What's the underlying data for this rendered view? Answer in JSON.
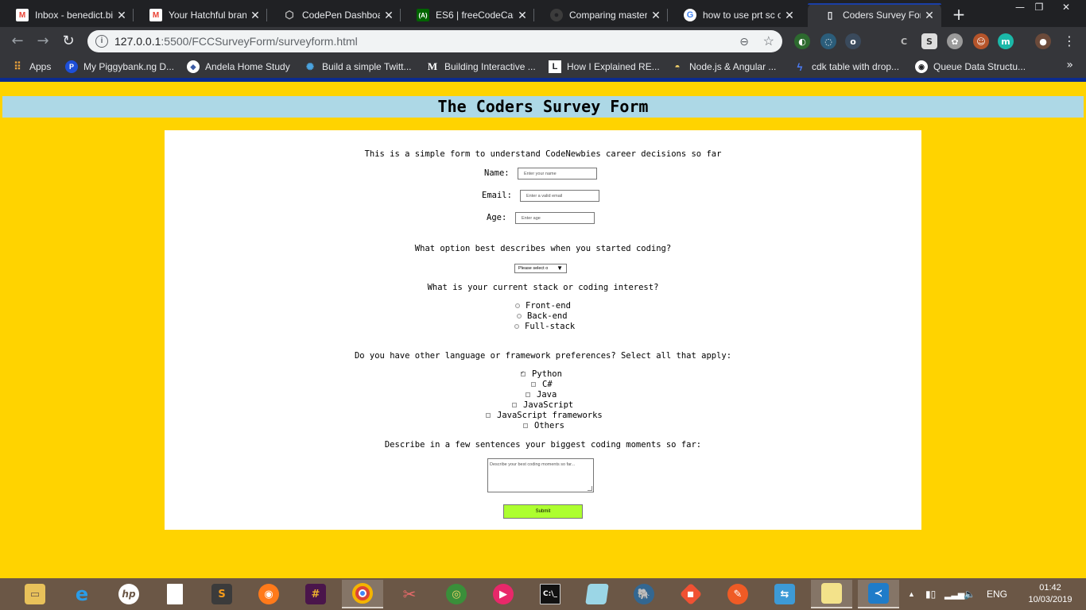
{
  "browser": {
    "tabs": [
      {
        "title": "Inbox - benedict.bi",
        "icon": "gmail-icon",
        "active": false
      },
      {
        "title": "Your Hatchful brand",
        "icon": "gmail-icon",
        "active": false
      },
      {
        "title": "CodePen Dashboar",
        "icon": "codepen-icon",
        "active": false
      },
      {
        "title": "ES6 | freeCodeCam",
        "icon": "freecodecamp-icon",
        "active": false
      },
      {
        "title": "Comparing master..",
        "icon": "github-icon",
        "active": false
      },
      {
        "title": "how to use prt sc o",
        "icon": "google-icon",
        "active": false
      },
      {
        "title": "Coders Survey Form",
        "icon": "document-icon",
        "active": true
      }
    ],
    "new_tab": "+",
    "window": {
      "minimize": "—",
      "restore": "❐",
      "close": "✕"
    },
    "address": {
      "host": "127.0.0.1",
      "path": ":5500/FCCSurveyForm/surveyform.html"
    },
    "bookmarks": [
      {
        "label": "Apps",
        "icon": "apps-grid-icon"
      },
      {
        "label": "My Piggybank.ng D...",
        "icon": "piggybank-icon"
      },
      {
        "label": "Andela Home Study",
        "icon": "andela-icon"
      },
      {
        "label": "Build a simple Twitt...",
        "icon": "loader-icon"
      },
      {
        "label": "Building Interactive ...",
        "icon": "medium-icon"
      },
      {
        "label": "How I Explained RE...",
        "icon": "l-icon"
      },
      {
        "label": "Node.js & Angular ...",
        "icon": "bowl-icon"
      },
      {
        "label": "cdk table with drop...",
        "icon": "bolt-icon"
      },
      {
        "label": "Queue Data Structu...",
        "icon": "owl-icon"
      }
    ],
    "bookmarks_more": "»",
    "colors": {
      "frame": "#202124",
      "toolbar": "#35363a",
      "active_tab_accent": "#1a3fa6"
    }
  },
  "survey": {
    "title": "The Coders Survey Form",
    "intro": "This is a simple form to understand CodeNewbies career decisions so far",
    "name_label": "Name:",
    "name_placeholder": "Enter your name",
    "email_label": "Email:",
    "email_placeholder": "Enter a valid email",
    "age_label": "Age:",
    "age_placeholder": "Enter age",
    "start_question": "What option best describes when you started coding?",
    "start_select_value": "Please select o",
    "stack_question": "What is your current stack or coding interest?",
    "stack_options": [
      "Front-end",
      "Back-end",
      "Full-stack"
    ],
    "lang_question": "Do you have other language or framework preferences? Select all that apply:",
    "lang_options": [
      {
        "label": "Python",
        "checked": true
      },
      {
        "label": "C#",
        "checked": false
      },
      {
        "label": "Java",
        "checked": false
      },
      {
        "label": "JavaScript",
        "checked": false
      },
      {
        "label": "JavaScript frameworks",
        "checked": false
      },
      {
        "label": "Others",
        "checked": false
      }
    ],
    "moments_question": "Describe in a few sentences your biggest coding moments so far:",
    "moments_placeholder": "Describe your best coding moments so far...",
    "submit_label": "Submit",
    "colors": {
      "page_bg": "#ffd300",
      "header_bg": "#add8e6",
      "card_bg": "#ffffff",
      "submit_bg": "#adff2f"
    }
  },
  "taskbar": {
    "apps": [
      "file-explorer-icon",
      "internet-explorer-icon",
      "hp-icon",
      "notepad-icon",
      "sublime-text-icon",
      "firefox-icon",
      "slack-icon",
      "chrome-icon",
      "snipping-tool-icon",
      "globe-icon",
      "media-player-icon",
      "terminal-icon",
      "notes-icon",
      "postgresql-icon",
      "git-icon",
      "postman-icon",
      "network-icon",
      "sticky-notes-icon",
      "vscode-icon"
    ],
    "language": "ENG",
    "time": "01:42",
    "date": "10/03/2019",
    "color": "#6b5746"
  }
}
